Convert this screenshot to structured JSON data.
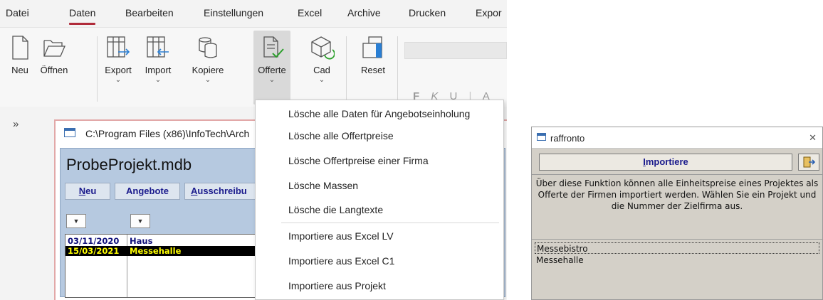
{
  "menubar": {
    "tabs": [
      "Datei",
      "Daten",
      "Bearbeiten",
      "Einstellungen",
      "Excel",
      "Archive",
      "Drucken",
      "Expor"
    ],
    "active_tab": "Daten",
    "accent_color": "#b02b3a"
  },
  "ribbon": {
    "buttons": [
      {
        "label": "Neu",
        "icon": "new-document-icon"
      },
      {
        "label": "Öffnen",
        "icon": "open-folder-icon"
      },
      {
        "label": "Export",
        "icon": "export-table-icon",
        "has_dropdown": true
      },
      {
        "label": "Import",
        "icon": "import-table-icon",
        "has_dropdown": true
      },
      {
        "label": "Kopiere",
        "icon": "copy-database-icon",
        "has_dropdown": true
      },
      {
        "label": "Offerte",
        "icon": "offer-document-check-icon",
        "has_dropdown": true,
        "active": true
      },
      {
        "label": "Cad",
        "icon": "cad-cube-icon",
        "has_dropdown": true
      },
      {
        "label": "Reset",
        "icon": "reset-window-icon"
      }
    ],
    "format": {
      "bold": "F",
      "italic": "K",
      "underline": "U",
      "font_color": "A",
      "chevron": "⌄"
    }
  },
  "collapse_glyph": "»",
  "doc_window": {
    "path": "C:\\Program Files (x86)\\InfoTech\\Arch",
    "project_title": "ProbeProjekt.mdb",
    "buttons": [
      {
        "label": "Neu",
        "underline": "N"
      },
      {
        "label": "Angebote"
      },
      {
        "label": "Ausschreibu",
        "underline": "A"
      }
    ],
    "dropdown_glyph": "▼",
    "rows": [
      {
        "date": "03/11/2020",
        "name": "Haus"
      },
      {
        "date": "15/03/2021",
        "name": "Messehalle",
        "selected": true
      }
    ]
  },
  "offerte_menu": {
    "items": [
      "Lösche alle Daten für Angebotseinholung",
      "Lösche alle Offertpreise",
      "Lösche Offertpreise einer Firma",
      "Lösche Massen",
      "Lösche die Langtexte",
      "Importiere aus Excel LV",
      "Importiere aus Excel C1",
      "Importiere aus Projekt"
    ]
  },
  "dialog": {
    "title": "raffronto",
    "close_glyph": "✕",
    "import_button": "Importiere",
    "import_underline": "I",
    "description": "Über diese Funktion können alle Einheitspreise eines Projektes als Offerte der Firmen importiert werden. Wählen Sie ein Projekt und die Nummer der Zielfirma aus.",
    "list": [
      "Messebistro",
      "Messehalle"
    ]
  }
}
